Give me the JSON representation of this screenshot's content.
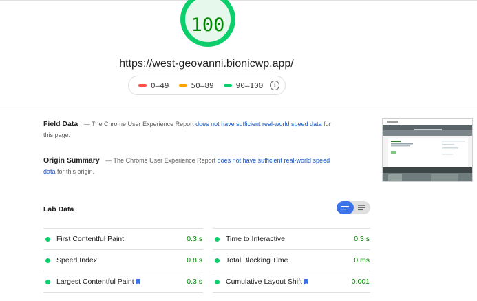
{
  "score": {
    "value": "100"
  },
  "url": "https://west-geovanni.bionicwp.app/",
  "legend": {
    "items": [
      {
        "label": "0–49",
        "color": "#ff4e42"
      },
      {
        "label": "50–89",
        "color": "#ffa400"
      },
      {
        "label": "90–100",
        "color": "#0cce6b"
      }
    ],
    "info_icon": "info-icon"
  },
  "field_data": {
    "title": "Field Data",
    "text_pre": "— The Chrome User Experience Report",
    "link": "does not have sufficient real-world speed data",
    "text_post": "for this page."
  },
  "origin_summary": {
    "title": "Origin Summary",
    "text_pre": "— The Chrome User Experience Report",
    "link": "does not have sufficient real-world speed data",
    "text_post": "for this origin."
  },
  "lab_data": {
    "title": "Lab Data",
    "metrics": [
      {
        "name": "First Contentful Paint",
        "value": "0.3 s",
        "flag": false
      },
      {
        "name": "Time to Interactive",
        "value": "0.3 s",
        "flag": false
      },
      {
        "name": "Speed Index",
        "value": "0.8 s",
        "flag": false
      },
      {
        "name": "Total Blocking Time",
        "value": "0 ms",
        "flag": false
      },
      {
        "name": "Largest Contentful Paint",
        "value": "0.3 s",
        "flag": true
      },
      {
        "name": "Cumulative Layout Shift",
        "value": "0.001",
        "flag": true
      }
    ]
  },
  "colors": {
    "pass": "#0cce6b",
    "pass_text": "#008800",
    "link": "#1a56c4",
    "toggle_active": "#3b73e8"
  }
}
